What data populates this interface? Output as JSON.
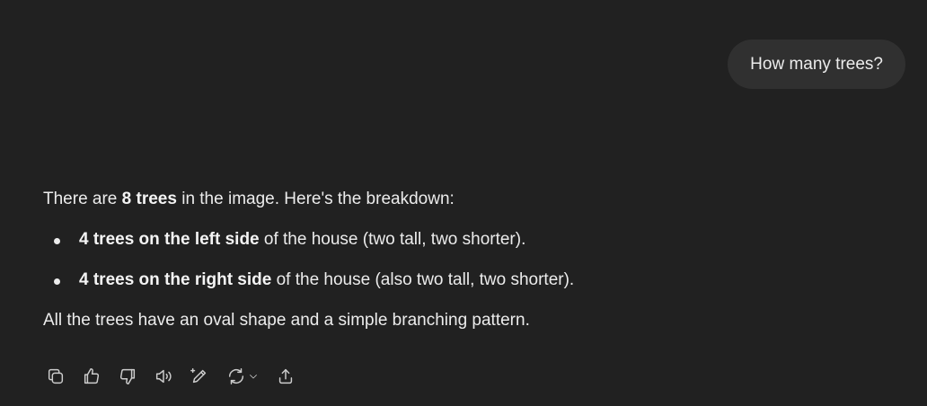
{
  "user_message": "How many trees?",
  "assistant": {
    "intro_prefix": "There are ",
    "intro_bold": "8 trees",
    "intro_suffix": " in the image. Here's the breakdown:",
    "bullets": [
      {
        "bold": "4 trees on the left side",
        "rest": " of the house (two tall, two shorter)."
      },
      {
        "bold": "4 trees on the right side",
        "rest": " of the house (also two tall, two shorter)."
      }
    ],
    "outro": "All the trees have an oval shape and a simple branching pattern."
  },
  "actions": [
    {
      "name": "copy-icon"
    },
    {
      "name": "thumbs-up-icon"
    },
    {
      "name": "thumbs-down-icon"
    },
    {
      "name": "read-aloud-icon"
    },
    {
      "name": "edit-canvas-icon"
    },
    {
      "name": "regenerate-icon"
    },
    {
      "name": "share-icon"
    }
  ]
}
